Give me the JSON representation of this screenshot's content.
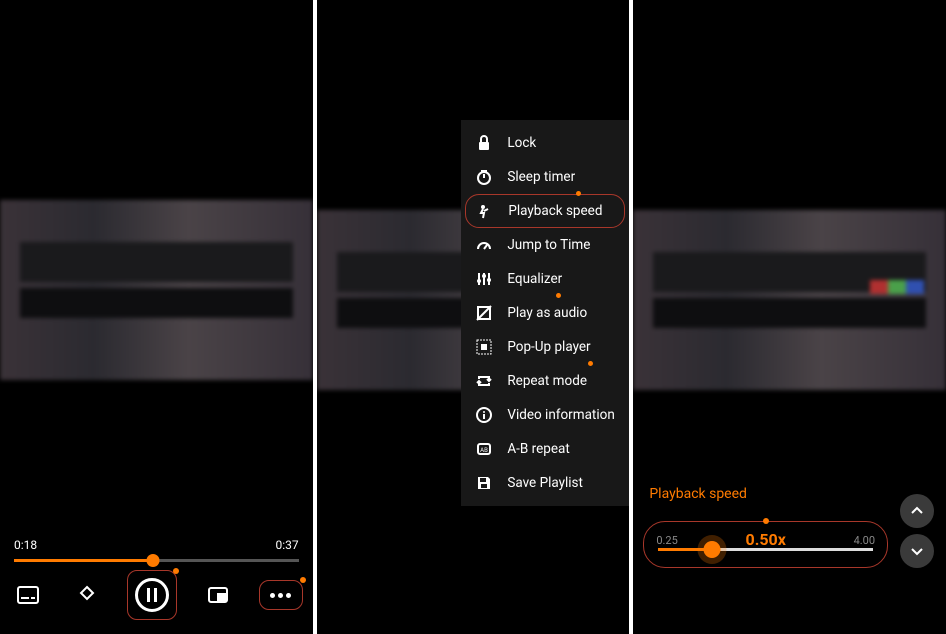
{
  "panel1": {
    "current_time": "0:18",
    "total_time": "0:37",
    "seek_percent": 49
  },
  "panel2": {
    "menu": [
      {
        "label": "Lock",
        "icon": "lock-icon",
        "highlighted": false
      },
      {
        "label": "Sleep timer",
        "icon": "timer-icon",
        "highlighted": false
      },
      {
        "label": "Playback speed",
        "icon": "speed-icon",
        "highlighted": true
      },
      {
        "label": "Jump to Time",
        "icon": "jump-icon",
        "highlighted": false
      },
      {
        "label": "Equalizer",
        "icon": "equalizer-icon",
        "highlighted": false
      },
      {
        "label": "Play as audio",
        "icon": "audio-icon",
        "highlighted": false
      },
      {
        "label": "Pop-Up player",
        "icon": "popup-icon",
        "highlighted": false
      },
      {
        "label": "Repeat mode",
        "icon": "repeat-icon",
        "highlighted": false
      },
      {
        "label": "Video information",
        "icon": "info-icon",
        "highlighted": false
      },
      {
        "label": "A-B repeat",
        "icon": "abrepeat-icon",
        "highlighted": false
      },
      {
        "label": "Save Playlist",
        "icon": "save-icon",
        "highlighted": false
      }
    ]
  },
  "panel3": {
    "title": "Playback speed",
    "value_label": "0.50x",
    "min_label": "0.25",
    "max_label": "4.00",
    "slider_percent": 25
  },
  "colors": {
    "accent": "#ff7b00",
    "highlight_border": "#a8372a"
  }
}
